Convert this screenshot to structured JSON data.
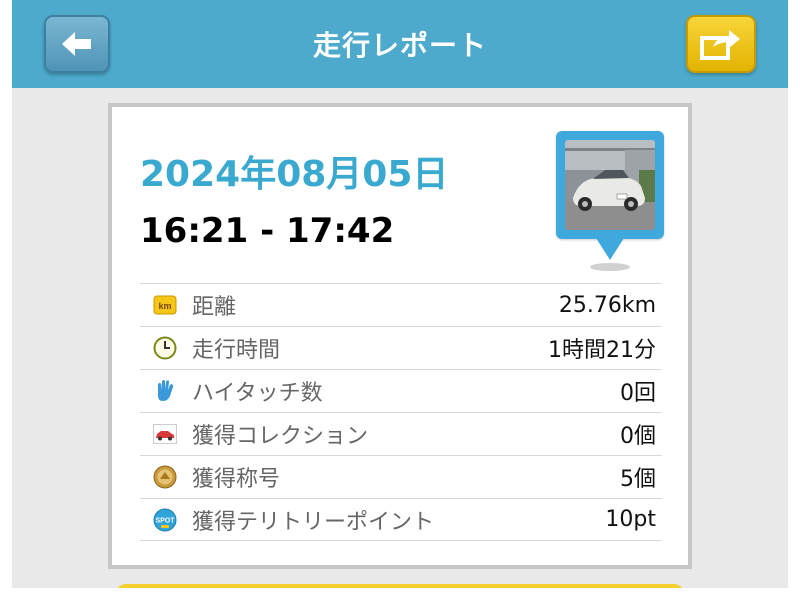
{
  "header": {
    "title": "走行レポート"
  },
  "report": {
    "date": "2024年08月05日",
    "time_range": "16:21 - 17:42"
  },
  "stats": [
    {
      "label": "距離",
      "value": "25.76km",
      "icon": "km-icon"
    },
    {
      "label": "走行時間",
      "value": "1時間21分",
      "icon": "clock-icon"
    },
    {
      "label": "ハイタッチ数",
      "value": "0回",
      "icon": "hand-icon"
    },
    {
      "label": "獲得コレクション",
      "value": "0個",
      "icon": "car-collection-icon"
    },
    {
      "label": "獲得称号",
      "value": "5個",
      "icon": "medal-icon"
    },
    {
      "label": "獲得テリトリーポイント",
      "value": "10pt",
      "icon": "spot-icon"
    }
  ],
  "icons": {
    "km_label": "km",
    "spot_label": "SPOT"
  },
  "colors": {
    "header": "#4daacc",
    "date": "#3aa9cf",
    "share_button": "#f0c419",
    "back_button": "#5f9fc0"
  }
}
